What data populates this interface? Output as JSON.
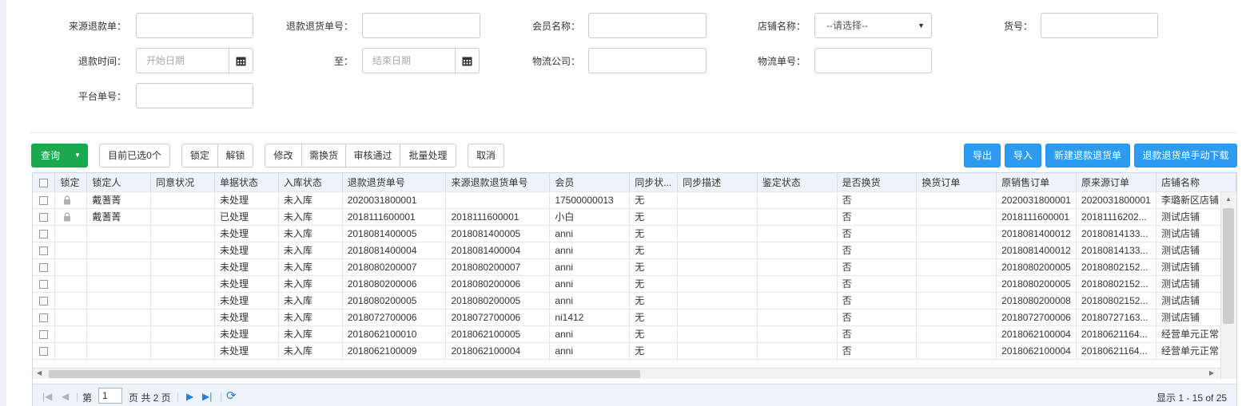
{
  "form": {
    "source_refund_label": "来源退款单：",
    "refund_return_no_label": "退款退货单号：",
    "member_name_label": "会员名称：",
    "shop_name_label": "店铺名称：",
    "shop_name_select": "--请选择--",
    "sku_label": "货号：",
    "refund_time_label": "退款时间：",
    "start_date_placeholder": "开始日期",
    "to_label": "至：",
    "end_date_placeholder": "结束日期",
    "logistics_company_label": "物流公司：",
    "logistics_no_label": "物流单号：",
    "platform_no_label": "平台单号："
  },
  "toolbar": {
    "query": "查询",
    "selected_count": "目前已选0个",
    "lock": "锁定",
    "unlock": "解锁",
    "edit": "修改",
    "need_exchange": "需换货",
    "approve": "审核通过",
    "batch": "批量处理",
    "cancel": "取消",
    "export": "导出",
    "import": "导入",
    "new_refund": "新建退款退货单",
    "manual_download": "退款退货单手动下载"
  },
  "colors": {
    "query_green": "#1aa94f",
    "primary_blue": "#2d9bf0"
  },
  "table": {
    "columns": [
      "锁定",
      "锁定人",
      "同意状况",
      "单据状态",
      "入库状态",
      "退款退货单号",
      "来源退款退货单号",
      "会员",
      "同步状...",
      "同步描述",
      "鉴定状态",
      "是否换货",
      "换货订单",
      "原销售订单",
      "原来源订单",
      "店铺名称"
    ],
    "rows": [
      {
        "locked": true,
        "locker": "戴蓍菁",
        "agree": "",
        "doc_status": "未处理",
        "stock_status": "未入库",
        "refund_no": "2020031800001",
        "source_no": "",
        "member": "17500000013",
        "sync": "无",
        "sync_desc": "",
        "appraisal": "",
        "exchange": "否",
        "exchange_order": "",
        "orig_sale": "2020031800001",
        "orig_source": "2020031800001",
        "shop": "李璐新区店铺"
      },
      {
        "locked": true,
        "locker": "戴蓍菁",
        "agree": "",
        "doc_status": "已处理",
        "stock_status": "未入库",
        "refund_no": "2018111600001",
        "source_no": "2018111600001",
        "member": "小白",
        "sync": "无",
        "sync_desc": "",
        "appraisal": "",
        "exchange": "否",
        "exchange_order": "",
        "orig_sale": "2018111600001",
        "orig_source": "20181116202...",
        "shop": "测试店铺"
      },
      {
        "locked": false,
        "locker": "",
        "agree": "",
        "doc_status": "未处理",
        "stock_status": "未入库",
        "refund_no": "2018081400005",
        "source_no": "2018081400005",
        "member": "anni",
        "sync": "无",
        "sync_desc": "",
        "appraisal": "",
        "exchange": "否",
        "exchange_order": "",
        "orig_sale": "2018081400012",
        "orig_source": "20180814133...",
        "shop": "测试店铺"
      },
      {
        "locked": false,
        "locker": "",
        "agree": "",
        "doc_status": "未处理",
        "stock_status": "未入库",
        "refund_no": "2018081400004",
        "source_no": "2018081400004",
        "member": "anni",
        "sync": "无",
        "sync_desc": "",
        "appraisal": "",
        "exchange": "否",
        "exchange_order": "",
        "orig_sale": "2018081400012",
        "orig_source": "20180814133...",
        "shop": "测试店铺"
      },
      {
        "locked": false,
        "locker": "",
        "agree": "",
        "doc_status": "未处理",
        "stock_status": "未入库",
        "refund_no": "2018080200007",
        "source_no": "2018080200007",
        "member": "anni",
        "sync": "无",
        "sync_desc": "",
        "appraisal": "",
        "exchange": "否",
        "exchange_order": "",
        "orig_sale": "2018080200005",
        "orig_source": "20180802152...",
        "shop": "测试店铺"
      },
      {
        "locked": false,
        "locker": "",
        "agree": "",
        "doc_status": "未处理",
        "stock_status": "未入库",
        "refund_no": "2018080200006",
        "source_no": "2018080200006",
        "member": "anni",
        "sync": "无",
        "sync_desc": "",
        "appraisal": "",
        "exchange": "否",
        "exchange_order": "",
        "orig_sale": "2018080200005",
        "orig_source": "20180802152...",
        "shop": "测试店铺"
      },
      {
        "locked": false,
        "locker": "",
        "agree": "",
        "doc_status": "未处理",
        "stock_status": "未入库",
        "refund_no": "2018080200005",
        "source_no": "2018080200005",
        "member": "anni",
        "sync": "无",
        "sync_desc": "",
        "appraisal": "",
        "exchange": "否",
        "exchange_order": "",
        "orig_sale": "2018080200008",
        "orig_source": "20180802152...",
        "shop": "测试店铺"
      },
      {
        "locked": false,
        "locker": "",
        "agree": "",
        "doc_status": "未处理",
        "stock_status": "未入库",
        "refund_no": "2018072700006",
        "source_no": "2018072700006",
        "member": "ni1412",
        "sync": "无",
        "sync_desc": "",
        "appraisal": "",
        "exchange": "否",
        "exchange_order": "",
        "orig_sale": "2018072700006",
        "orig_source": "20180727163...",
        "shop": "测试店铺"
      },
      {
        "locked": false,
        "locker": "",
        "agree": "",
        "doc_status": "未处理",
        "stock_status": "未入库",
        "refund_no": "2018062100010",
        "source_no": "2018062100005",
        "member": "anni",
        "sync": "无",
        "sync_desc": "",
        "appraisal": "",
        "exchange": "否",
        "exchange_order": "",
        "orig_sale": "2018062100004",
        "orig_source": "20180621164...",
        "shop": "经营单元正常"
      },
      {
        "locked": false,
        "locker": "",
        "agree": "",
        "doc_status": "未处理",
        "stock_status": "未入库",
        "refund_no": "2018062100009",
        "source_no": "2018062100004",
        "member": "anni",
        "sync": "无",
        "sync_desc": "",
        "appraisal": "",
        "exchange": "否",
        "exchange_order": "",
        "orig_sale": "2018062100004",
        "orig_source": "20180621164...",
        "shop": "经营单元正常"
      }
    ]
  },
  "pager": {
    "page_label": "第",
    "page_value": "1",
    "total_label": "页 共 2 页",
    "display_info": "显示 1 - 15 of 25"
  }
}
